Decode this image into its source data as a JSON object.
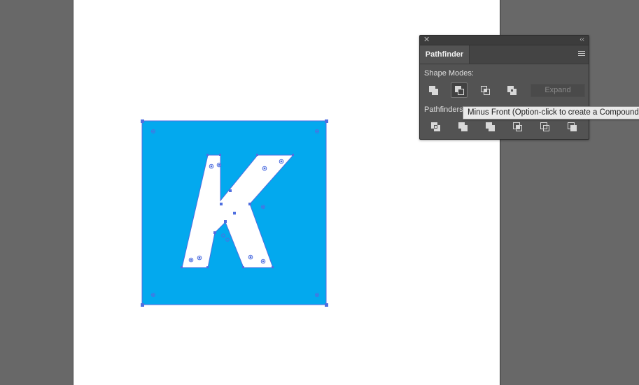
{
  "colors": {
    "workspace": "#686868",
    "artboard": "#ffffff",
    "square_fill": "#03a9ee",
    "selection": "#4f6fe0",
    "panel_bg": "#535353"
  },
  "canvas": {
    "artwork_letter": "K"
  },
  "panel": {
    "close_icon": "close-icon",
    "collapse_glyph": "‹‹",
    "tab_label": "Pathfinder",
    "menu_icon": "panel-menu-icon",
    "shape_modes_label": "Shape Modes:",
    "shape_modes": [
      {
        "name": "unite",
        "icon": "unite-icon"
      },
      {
        "name": "minus-front",
        "icon": "minus-front-icon",
        "active": true
      },
      {
        "name": "intersect",
        "icon": "intersect-icon"
      },
      {
        "name": "exclude",
        "icon": "exclude-icon"
      }
    ],
    "expand_label": "Expand",
    "pathfinders_label": "Pathfinders:",
    "pathfinders": [
      {
        "name": "divide",
        "icon": "divide-icon"
      },
      {
        "name": "trim",
        "icon": "trim-icon"
      },
      {
        "name": "merge",
        "icon": "merge-icon"
      },
      {
        "name": "crop",
        "icon": "crop-icon"
      },
      {
        "name": "outline",
        "icon": "outline-icon"
      },
      {
        "name": "minus-back",
        "icon": "minus-back-icon"
      }
    ]
  },
  "tooltip": {
    "text": "Minus Front (Option-click to create a Compound Shape)"
  }
}
